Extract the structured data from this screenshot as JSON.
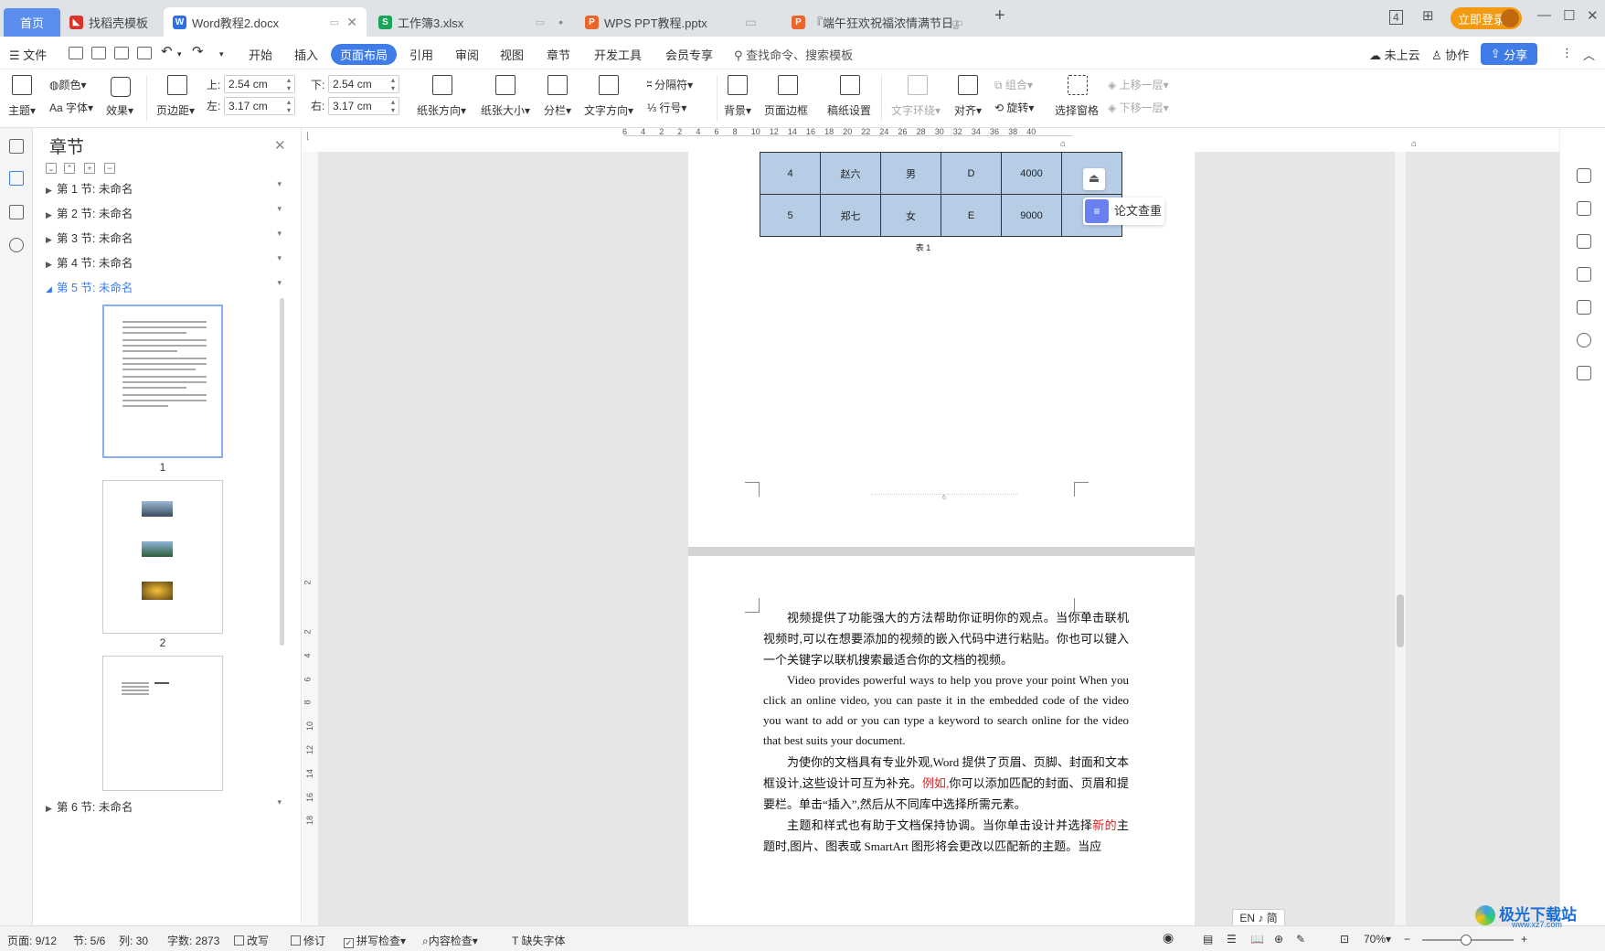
{
  "tabs": [
    {
      "label": "首页",
      "type": "home"
    },
    {
      "label": "找稻壳模板",
      "icon_color": "#d9342b"
    },
    {
      "label": "Word教程2.docx",
      "icon_color": "#2f6fe4",
      "active": true
    },
    {
      "label": "工作簿3.xlsx",
      "icon_color": "#1aa35a"
    },
    {
      "label": "WPS PPT教程.pptx",
      "icon_color": "#e8662b"
    },
    {
      "label": "『端午狂欢祝福浓情满节日』",
      "icon_color": "#e8662b"
    }
  ],
  "tab_icons": [
    "W",
    "S",
    "P",
    "P"
  ],
  "new_tab": "+",
  "window": {
    "login": "立即登录",
    "minimize": "—",
    "restore": "☐",
    "close": "✕"
  },
  "menu": {
    "file": "文件",
    "items": [
      "开始",
      "插入",
      "页面布局",
      "引用",
      "审阅",
      "视图",
      "章节",
      "开发工具",
      "会员专享"
    ],
    "active": "页面布局",
    "search": "查找命令、搜索模板",
    "cloud": "未上云",
    "collab": "协作",
    "share": "分享"
  },
  "ribbon": {
    "theme": "主题",
    "color": "颜色",
    "font": "Aa 字体",
    "effect": "效果",
    "margins": "页边距",
    "top_label": "上:",
    "top_val": "2.54 cm",
    "bottom_label": "下:",
    "bottom_val": "2.54 cm",
    "left_label": "左:",
    "left_val": "3.17 cm",
    "right_label": "右:",
    "right_val": "3.17 cm",
    "orientation": "纸张方向",
    "size": "纸张大小",
    "columns": "分栏",
    "text_dir": "文字方向",
    "break": "分隔符",
    "line_num": "行号",
    "background": "背景",
    "page_border": "页面边框",
    "manuscript": "稿纸设置",
    "wrap": "文字环绕",
    "align": "对齐",
    "group": "组合",
    "rotate": "旋转",
    "select_pane": "选择窗格",
    "bring_forward": "上移一层",
    "send_backward": "下移一层"
  },
  "nav": {
    "title": "章节",
    "sections": [
      "第 1 节: 未命名",
      "第 2 节: 未命名",
      "第 3 节: 未命名",
      "第 4 节: 未命名",
      "第 5 节: 未命名",
      "第 6 节: 未命名"
    ],
    "active_section": "第 5 节: 未命名",
    "thumb_nums": [
      "1",
      "2"
    ]
  },
  "ruler": {
    "h_ticks": [
      "6",
      "4",
      "2",
      "2",
      "4",
      "6",
      "8",
      "10",
      "12",
      "14",
      "16",
      "18",
      "20",
      "22",
      "24",
      "26",
      "28",
      "30",
      "32",
      "34",
      "36",
      "38",
      "40"
    ],
    "v_ticks": [
      "2",
      "2",
      "4",
      "6",
      "8",
      "10",
      "12",
      "14",
      "16",
      "18"
    ]
  },
  "table": {
    "rows": [
      [
        "4",
        "赵六",
        "男",
        "D",
        "4000",
        ""
      ],
      [
        "5",
        "郑七",
        "女",
        "E",
        "9000",
        ""
      ]
    ],
    "caption": "表 1"
  },
  "page_footer": "6",
  "float_panel": {
    "label": "论文查重"
  },
  "doc_text": {
    "p1": "视频提供了功能强大的方法帮助你证明你的观点。当你单击联机视频时,可以在想要添加的视频的嵌入代码中进行粘贴。你也可以键入一个关键字以联机搜索最适合你的文档的视频。",
    "p2": "Video provides powerful ways to help you prove your point When you click an online video, you can paste it in the embedded code of the video you want to add or you can type a keyword to search online for the video that best suits your document.",
    "p3a": "为使你的文档具有专业外观,Word 提供了页眉、页脚、封面和文本框设计,这些设计可互为补充。",
    "p3red": "例如,",
    "p3b": "你可以添加匹配的封面、页眉和提要栏。单击“插入”,然后从不同库中选择所需元素。",
    "p4a": "主题和样式也有助于文档保持协调。当你单击设计并选择",
    "p4red": "新的",
    "p4b": "主题时,图片、图表或 SmartArt 图形将会更改以匹配新的主题。当应"
  },
  "ime": "EN ♪ 简",
  "status": {
    "page": "页面: 9/12",
    "section": "节: 5/6",
    "column": "列: 30",
    "words": "字数: 2873",
    "rewrite": "改写",
    "revise": "修订",
    "spell": "拼写检查",
    "content_check": "内容检查",
    "missing_font": "缺失字体",
    "zoom": "70%"
  },
  "watermark": "极光下载站",
  "watermark_url": "www.xz7.com"
}
